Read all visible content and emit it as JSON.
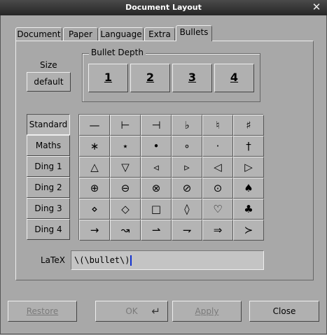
{
  "window": {
    "title": "Document Layout",
    "close_glyph": "✕"
  },
  "tabs": [
    {
      "label": "Document"
    },
    {
      "label": "Paper"
    },
    {
      "label": "Language"
    },
    {
      "label": "Extra"
    },
    {
      "label": "Bullets",
      "active": true
    }
  ],
  "size": {
    "label": "Size",
    "value": "default"
  },
  "bullet_depth": {
    "title": "Bullet Depth",
    "levels": [
      "1",
      "2",
      "3",
      "4"
    ],
    "selected": "1"
  },
  "families": [
    {
      "label": "Standard",
      "selected": true
    },
    {
      "label": "Maths"
    },
    {
      "label": "Ding 1"
    },
    {
      "label": "Ding 2"
    },
    {
      "label": "Ding 3"
    },
    {
      "label": "Ding 4"
    }
  ],
  "symbols": [
    [
      "—",
      "⊢",
      "⊣",
      "♭",
      "♮",
      "♯"
    ],
    [
      "∗",
      "⋆",
      "•",
      "∘",
      "·",
      "†"
    ],
    [
      "△",
      "▽",
      "◃",
      "▹",
      "◁",
      "▷"
    ],
    [
      "⊕",
      "⊖",
      "⊗",
      "⊘",
      "⊙",
      "♠"
    ],
    [
      "⋄",
      "◇",
      "□",
      "◊",
      "♡",
      "♣"
    ],
    [
      "→",
      "↝",
      "⇀",
      "⇁",
      "⇒",
      "≻"
    ]
  ],
  "latex": {
    "label": "LaTeX",
    "value": "\\(\\bullet\\)"
  },
  "buttons": {
    "restore": "Restore",
    "ok": "OK",
    "ok_icon": "enter-icon",
    "apply": "Apply",
    "close": "Close"
  }
}
